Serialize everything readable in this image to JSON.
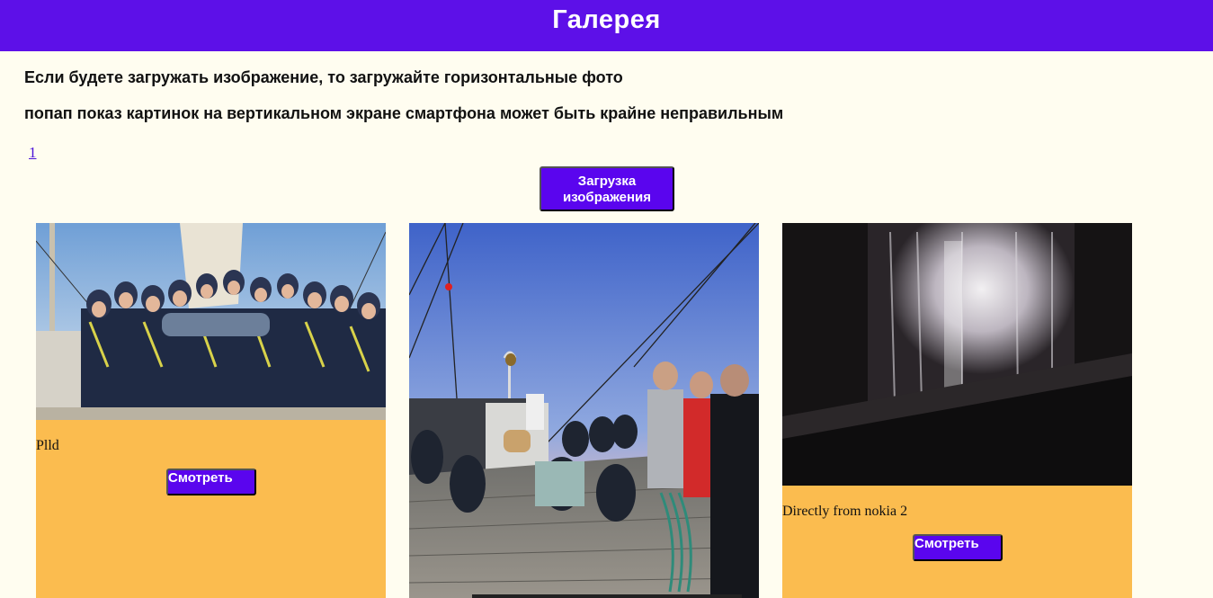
{
  "header": {
    "title": "Галерея"
  },
  "notices": {
    "line1": "Если будете загружать изображение, то загружайте горизонтальные фото",
    "line2": "попап показ картинок на вертикальном экране смартфона может быть крайне неправильным"
  },
  "pagination": {
    "current_page": "1"
  },
  "upload": {
    "label": "Загрузка изображения"
  },
  "gallery": {
    "cards": [
      {
        "caption": "Plld",
        "view_label": "Смотреть"
      },
      {
        "caption": "",
        "view_label": ""
      },
      {
        "caption": "Directly from nokia 2",
        "view_label": "Смотреть"
      }
    ]
  },
  "colors": {
    "header_bg": "#5d10e8",
    "button_bg": "#5a05ee",
    "card_bg": "#fbbc4f",
    "page_bg": "#fffdf0"
  }
}
